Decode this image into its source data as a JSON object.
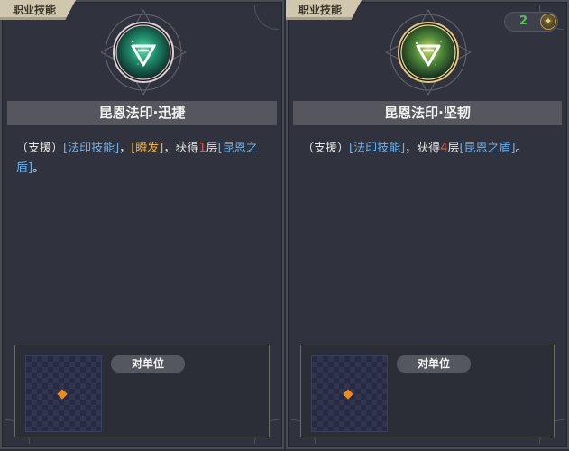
{
  "cards": [
    {
      "category": "职业技能",
      "title": "昆恩法印·迅捷",
      "description": {
        "support": "（支援）",
        "tag1": "[法印技能]",
        "sep1": "，",
        "tag2": "[瞬发]",
        "sep2": "，获得",
        "count": "1",
        "unit": "层",
        "tag3": "[昆恩之盾]",
        "end": "。"
      },
      "target_label": "对单位",
      "emblem_color": "#57e6a8"
    },
    {
      "category": "职业技能",
      "title": "昆恩法印·坚韧",
      "resource_count": "2",
      "resource_icon": "✦",
      "description": {
        "support": "（支援）",
        "tag1": "[法印技能]",
        "sep1": "，获得",
        "count": "4",
        "unit": "层",
        "tag2": "[昆恩之盾]",
        "end": "。"
      },
      "target_label": "对单位",
      "emblem_color": "#d9e66a"
    }
  ]
}
